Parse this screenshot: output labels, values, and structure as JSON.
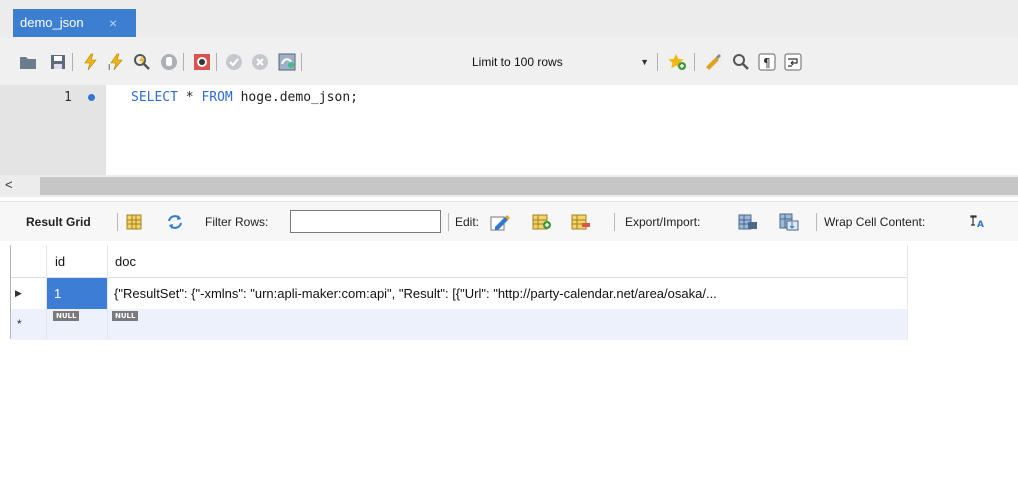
{
  "tabs": [
    {
      "label": "demo_json",
      "close": "×"
    }
  ],
  "toolbar": {
    "limit_select": "Limit to 100 rows",
    "icons": [
      "open-file-icon",
      "save-icon",
      "execute-icon",
      "execute-current-icon",
      "explain-icon",
      "stop-icon",
      "toggle-error-icon",
      "commit-icon",
      "rollback-icon",
      "autocommit-icon",
      "add-snippet-icon",
      "beautify-icon",
      "find-icon",
      "invisible-chars-icon",
      "wrap-lines-icon"
    ]
  },
  "editor": {
    "line_number": "1",
    "code": {
      "kw1": "SELECT",
      "star": " * ",
      "kw2": "FROM",
      "rest": " hoge.demo_json;"
    }
  },
  "scrollbar": {
    "left_arrow": "<"
  },
  "results": {
    "result_grid": "Result Grid",
    "filter_rows": "Filter Rows:",
    "edit": "Edit:",
    "export_import": "Export/Import:",
    "wrap_cell": "Wrap Cell Content:"
  },
  "grid": {
    "columns": [
      "id",
      "doc"
    ],
    "rows": [
      {
        "marker": "▶",
        "id": "1",
        "doc": "{\"ResultSet\": {\"-xmlns\": \"urn:apli-maker:com:api\", \"Result\": [{\"Url\": \"http://party-calendar.net/area/osaka/..."
      },
      {
        "marker": "*",
        "id": "NULL",
        "doc": "NULL"
      }
    ]
  },
  "colors": {
    "tab_active": "#3c7fd0",
    "selection": "#3e7dd6",
    "keyword": "#2f6bd3",
    "new_row": "#ecf1fb"
  }
}
